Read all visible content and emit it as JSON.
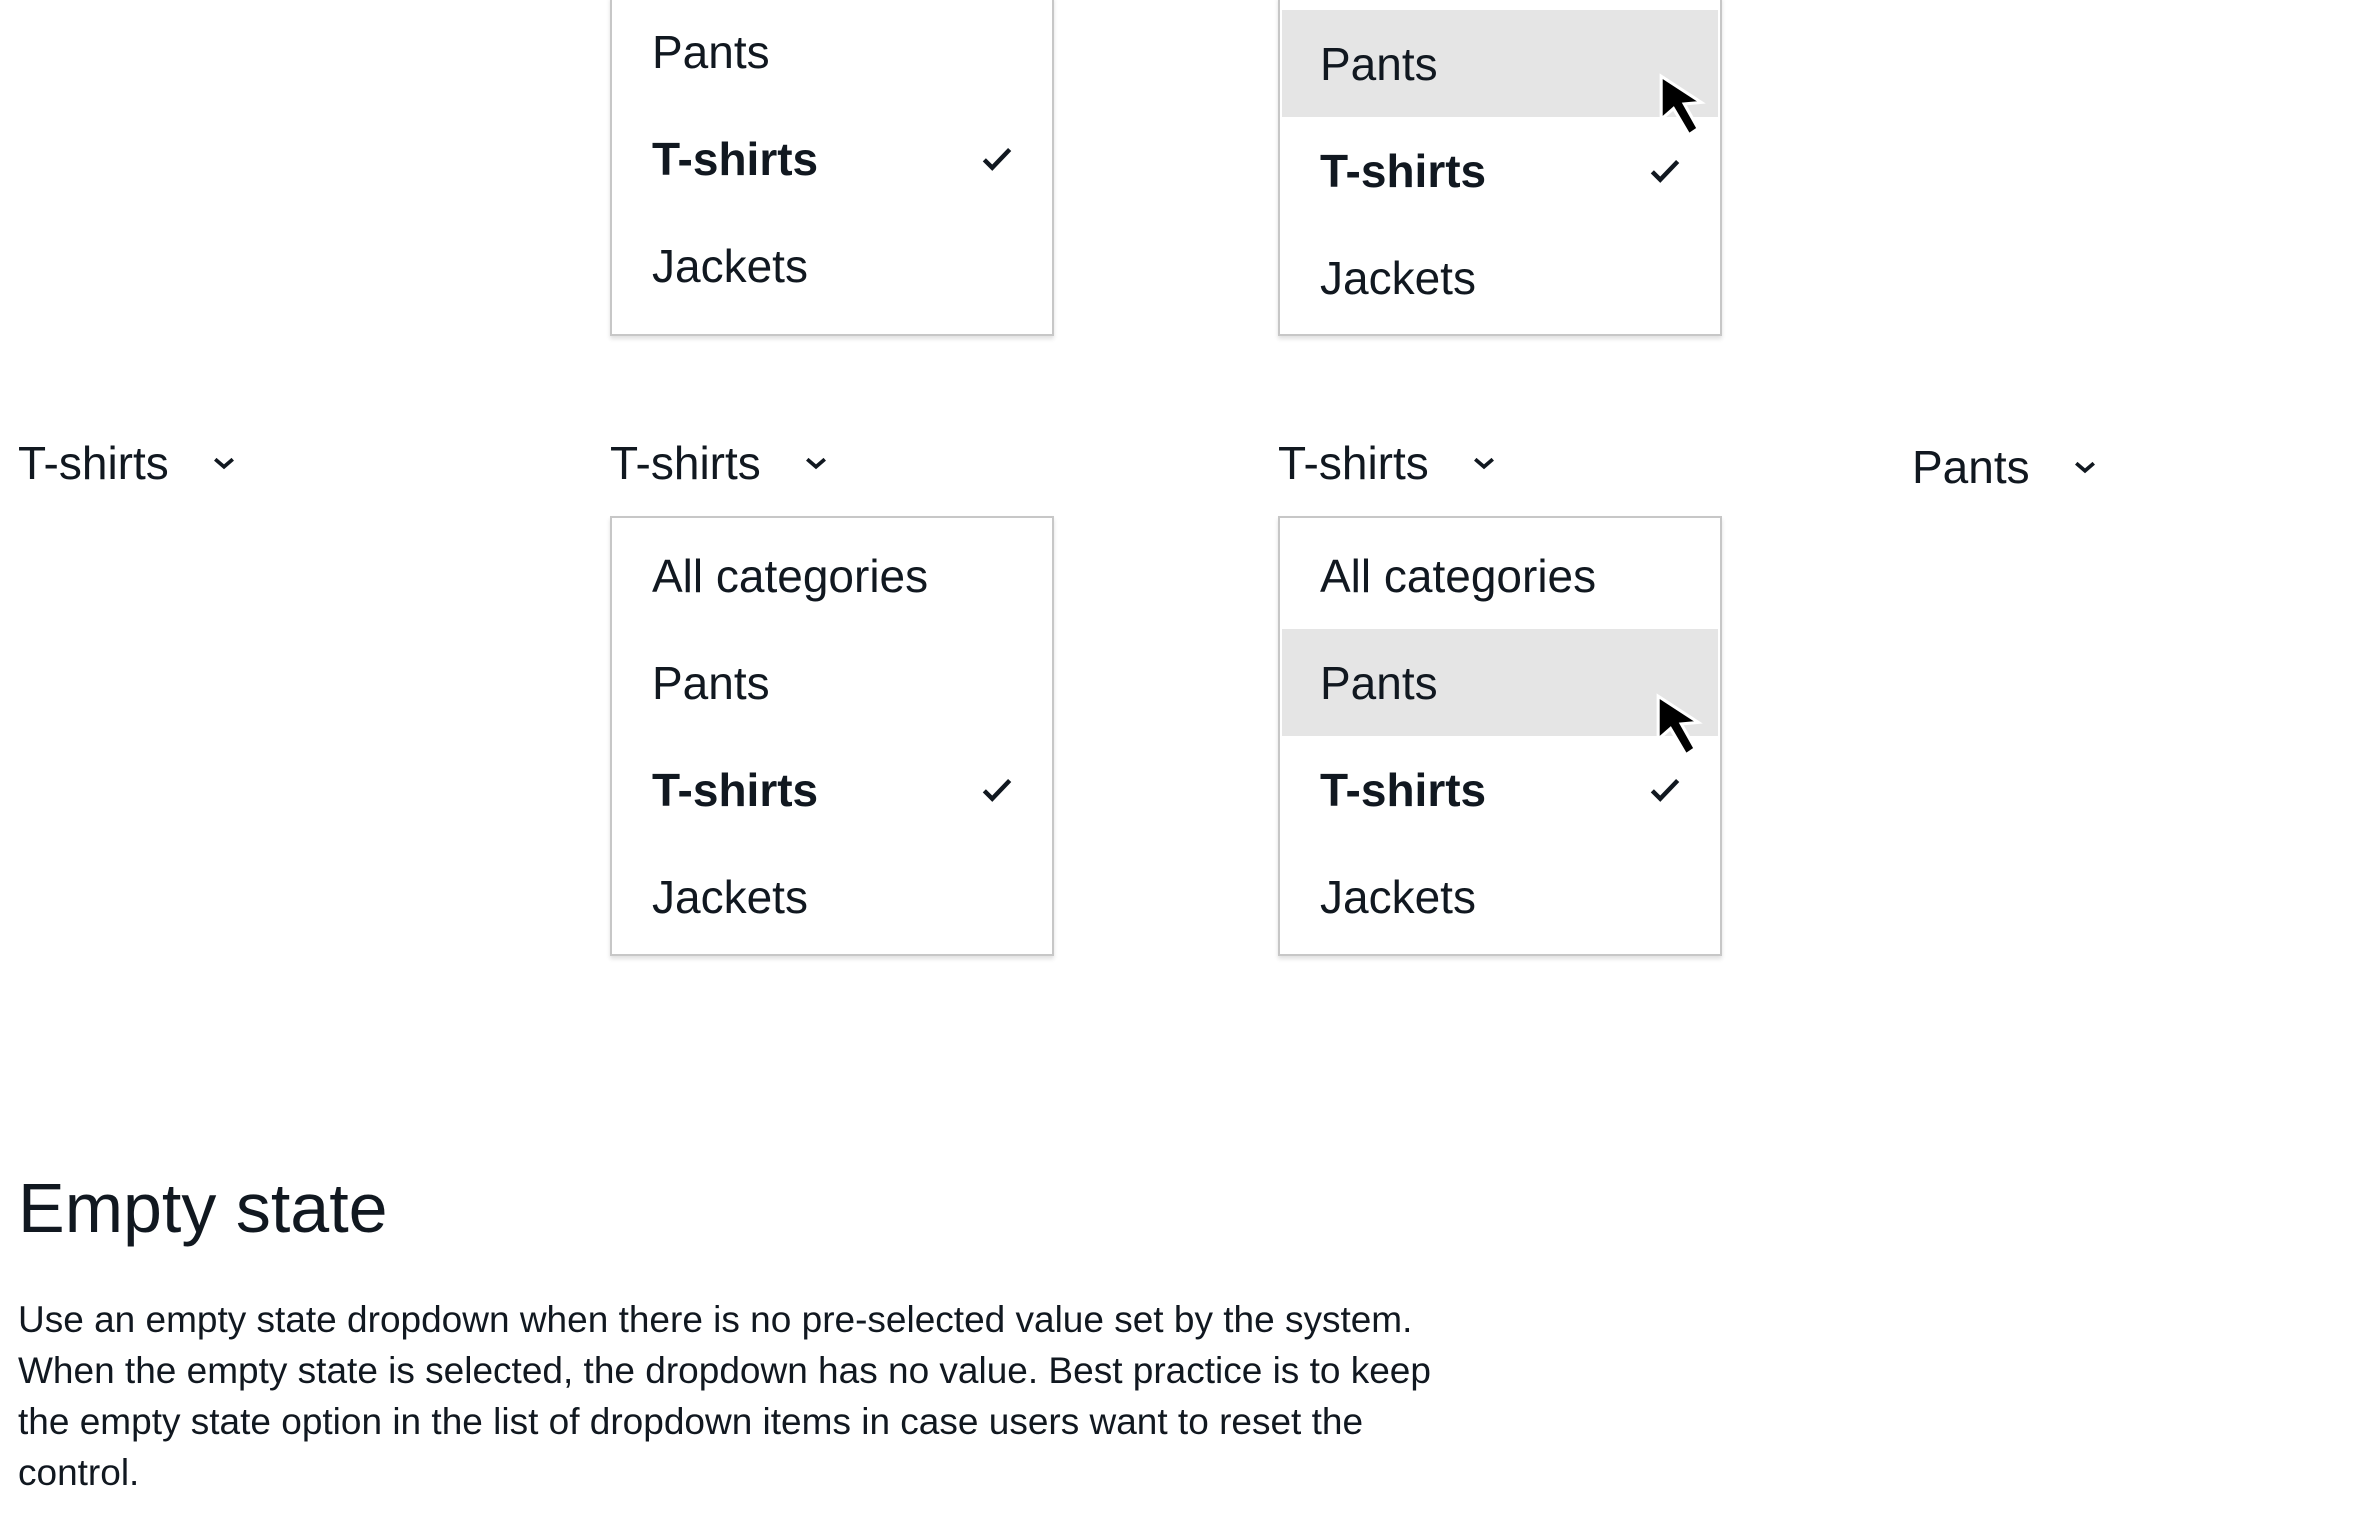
{
  "dropdowns": {
    "closed_1": {
      "value": "T-shirts"
    },
    "open_top_1": {
      "items": [
        "Pants",
        "T-shirts",
        "Jackets"
      ]
    },
    "open_top_2": {
      "items": [
        "Pants",
        "T-shirts",
        "Jackets"
      ]
    },
    "open_1": {
      "value": "T-shirts",
      "items": [
        "All categories",
        "Pants",
        "T-shirts",
        "Jackets"
      ]
    },
    "open_2": {
      "value": "T-shirts",
      "items": [
        "All categories",
        "Pants",
        "T-shirts",
        "Jackets"
      ]
    },
    "closed_2": {
      "value": "Pants"
    }
  },
  "section": {
    "title": "Empty state",
    "description": "Use an empty state dropdown when there is no pre-selected value set by the system. When the empty state is selected, the dropdown has no value. Best practice is to keep the empty state option in the list of dropdown items in case users want to reset the control."
  },
  "colors": {
    "text": "#111820",
    "hover": "#e5e5e5",
    "border": "#c7c7c7"
  }
}
